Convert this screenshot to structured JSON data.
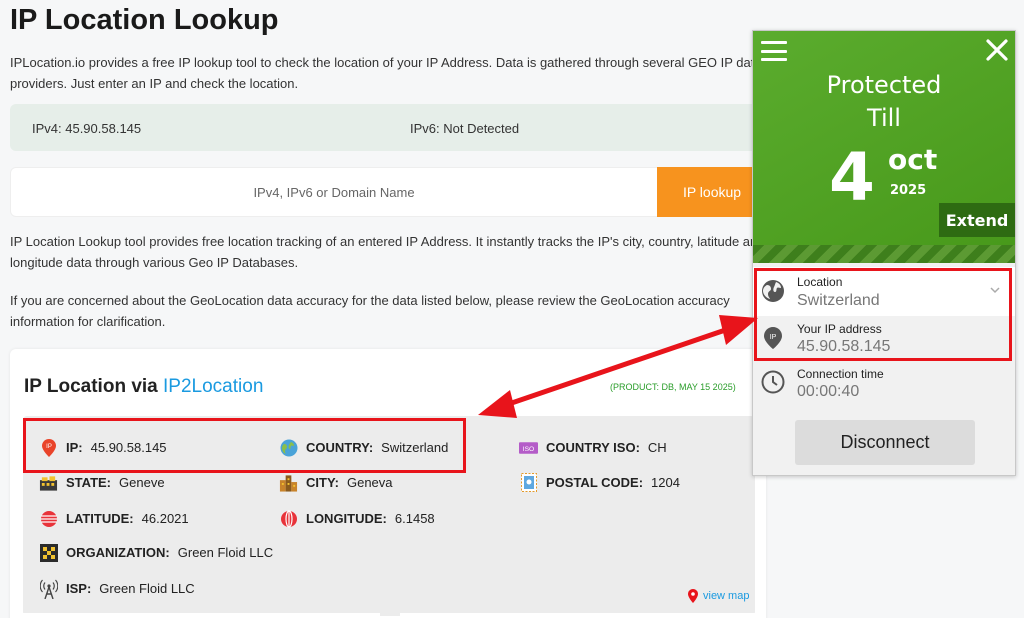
{
  "page": {
    "title": "IP Location Lookup",
    "intro": "IPLocation.io provides a free IP lookup tool to check the location of your IP Address. Data is gathered through several GEO IP data providers. Just enter an IP and check the location.",
    "ipv4": "IPv4: 45.90.58.145",
    "ipv6": "IPv6: Not Detected",
    "search_placeholder": "IPv4, IPv6 or Domain Name",
    "lookup_button": "IP lookup",
    "para1": "IP Location Lookup tool provides free location tracking of an entered IP Address. It instantly tracks the IP's city, country, latitude and longitude data through various Geo IP Databases.",
    "para2": "If you are concerned about the GeoLocation data accuracy for the data listed below, please review the GeoLocation accuracy information for clarification."
  },
  "result": {
    "title_prefix": "IP Location via ",
    "title_link": "IP2Location",
    "product": "(PRODUCT: DB, MAY 15 2025)",
    "fields": {
      "ip_label": "IP:",
      "ip_value": "45.90.58.145",
      "country_label": "COUNTRY:",
      "country_value": "Switzerland",
      "iso_label": "COUNTRY ISO:",
      "iso_value": "CH",
      "state_label": "STATE:",
      "state_value": "Geneve",
      "city_label": "CITY:",
      "city_value": "Geneva",
      "postal_label": "POSTAL CODE:",
      "postal_value": "1204",
      "lat_label": "LATITUDE:",
      "lat_value": "46.2021",
      "lon_label": "LONGITUDE:",
      "lon_value": "6.1458",
      "org_label": "ORGANIZATION:",
      "org_value": "Green Floid LLC",
      "isp_label": "ISP:",
      "isp_value": "Green Floid LLC",
      "iso_badge": "ISO"
    },
    "view_map": "view map"
  },
  "vpn": {
    "protected": "Protected",
    "till": "Till",
    "day": "4",
    "month": "oct",
    "year": "2025",
    "extend": "Extend",
    "location_label": "Location",
    "location_value": "Switzerland",
    "ip_label": "Your IP address",
    "ip_value": "45.90.58.145",
    "ip_badge": "IP",
    "time_label": "Connection time",
    "time_value": "00:00:40",
    "disconnect": "Disconnect"
  },
  "colors": {
    "accent_orange": "#f7931e",
    "link_blue": "#1a9ae0",
    "vpn_green": "#4da51c",
    "highlight_red": "#e8141b"
  }
}
